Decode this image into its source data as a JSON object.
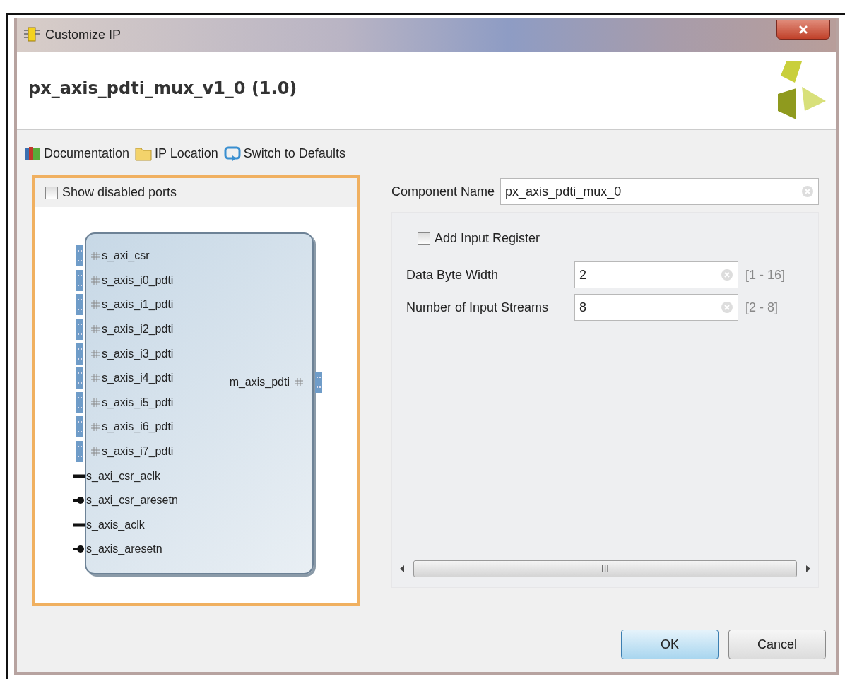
{
  "window": {
    "title": "Customize IP"
  },
  "header": {
    "title": "px_axis_pdti_mux_v1_0 (1.0)"
  },
  "toolbar": [
    {
      "kind": "docs",
      "label": "Documentation"
    },
    {
      "kind": "folder",
      "label": "IP Location"
    },
    {
      "kind": "reset",
      "label": "Switch to Defaults"
    }
  ],
  "symbol_panel": {
    "show_disabled_ports": {
      "label": "Show disabled ports",
      "checked": false
    },
    "left_ports": [
      {
        "kind": "bus",
        "name": "s_axi_csr"
      },
      {
        "kind": "bus",
        "name": "s_axis_i0_pdti"
      },
      {
        "kind": "bus",
        "name": "s_axis_i1_pdti"
      },
      {
        "kind": "bus",
        "name": "s_axis_i2_pdti"
      },
      {
        "kind": "bus",
        "name": "s_axis_i3_pdti"
      },
      {
        "kind": "bus",
        "name": "s_axis_i4_pdti"
      },
      {
        "kind": "bus",
        "name": "s_axis_i5_pdti"
      },
      {
        "kind": "bus",
        "name": "s_axis_i6_pdti"
      },
      {
        "kind": "bus",
        "name": "s_axis_i7_pdti"
      },
      {
        "kind": "clock",
        "name": "s_axi_csr_aclk"
      },
      {
        "kind": "reset",
        "name": "s_axi_csr_aresetn"
      },
      {
        "kind": "clock",
        "name": "s_axis_aclk"
      },
      {
        "kind": "reset",
        "name": "s_axis_aresetn"
      }
    ],
    "right_ports": [
      {
        "kind": "bus",
        "name": "m_axis_pdti"
      }
    ]
  },
  "component_name": {
    "label": "Component Name",
    "value": "px_axis_pdti_mux_0"
  },
  "parameters": {
    "add_input_register": {
      "label": "Add Input Register",
      "checked": false
    },
    "fields": [
      {
        "label": "Data Byte Width",
        "value": "2",
        "range": "[1 - 16]"
      },
      {
        "label": "Number of Input Streams",
        "value": "8",
        "range": "[2 - 8]"
      }
    ],
    "scrollbar_grip": "III"
  },
  "buttons": [
    {
      "label": "OK",
      "default": true
    },
    {
      "label": "Cancel",
      "default": false
    }
  ]
}
